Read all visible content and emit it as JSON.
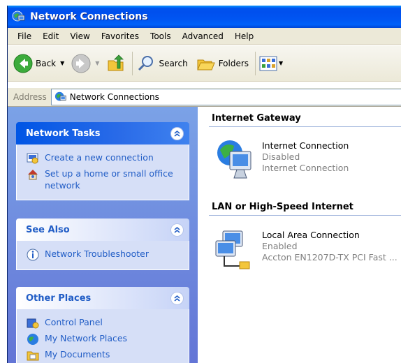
{
  "window": {
    "title": "Network Connections"
  },
  "menu": [
    "File",
    "Edit",
    "View",
    "Favorites",
    "Tools",
    "Advanced",
    "Help"
  ],
  "toolbar": {
    "back_label": "Back",
    "search_label": "Search",
    "folders_label": "Folders"
  },
  "address": {
    "label": "Address",
    "value": "Network Connections"
  },
  "sidebar": {
    "network_tasks": {
      "title": "Network Tasks",
      "items": [
        "Create a new connection",
        "Set up a home or small office network"
      ]
    },
    "see_also": {
      "title": "See Also",
      "items": [
        "Network Troubleshooter"
      ]
    },
    "other_places": {
      "title": "Other Places",
      "items": [
        "Control Panel",
        "My Network Places",
        "My Documents"
      ]
    }
  },
  "groups": [
    {
      "title": "Internet Gateway",
      "item": {
        "name": "Internet Connection",
        "status": "Disabled",
        "detail": "Internet Connection"
      }
    },
    {
      "title": "LAN or High-Speed Internet",
      "item": {
        "name": "Local Area Connection",
        "status": "Enabled",
        "detail": "Accton EN1207D-TX PCI Fast ..."
      }
    }
  ],
  "colors": {
    "title_bar": "#0053ee",
    "task_link": "#215dc6",
    "sidebar_bg": "#7ba2e7"
  }
}
